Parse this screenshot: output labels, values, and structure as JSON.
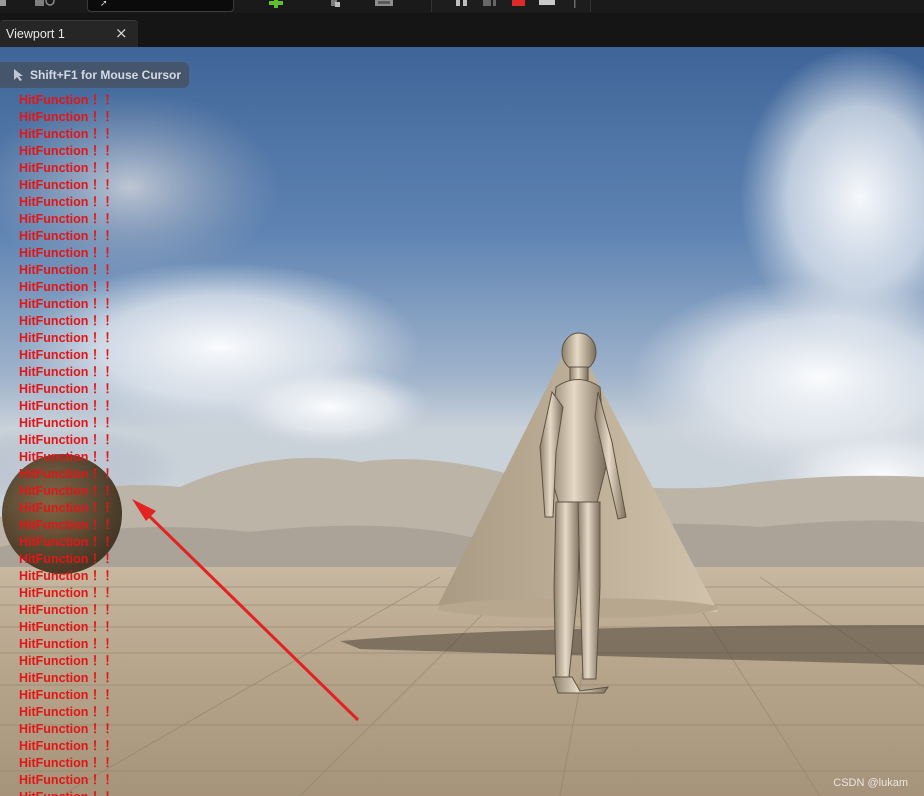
{
  "viewport": {
    "tab_label": "Viewport 1",
    "close_glyph": "×",
    "hint_text": "Shift+F1 for Mouse Cursor",
    "watermark": "CSDN @lukam"
  },
  "log": {
    "line_text": "HitFunction ！！",
    "line_count": 42
  },
  "icons": [
    "cursor-icon",
    "add-actor-icon",
    "close-icon",
    "mouse-pointer-icon",
    "pause-icon",
    "step-icon",
    "stop-icon",
    "eject-icon"
  ],
  "colors": {
    "log_text": "#e21616",
    "arrow": "#e32222",
    "add_icon": "#5ec02a",
    "stop_icon": "#e02a2a",
    "hint_bg": "#46505f"
  }
}
